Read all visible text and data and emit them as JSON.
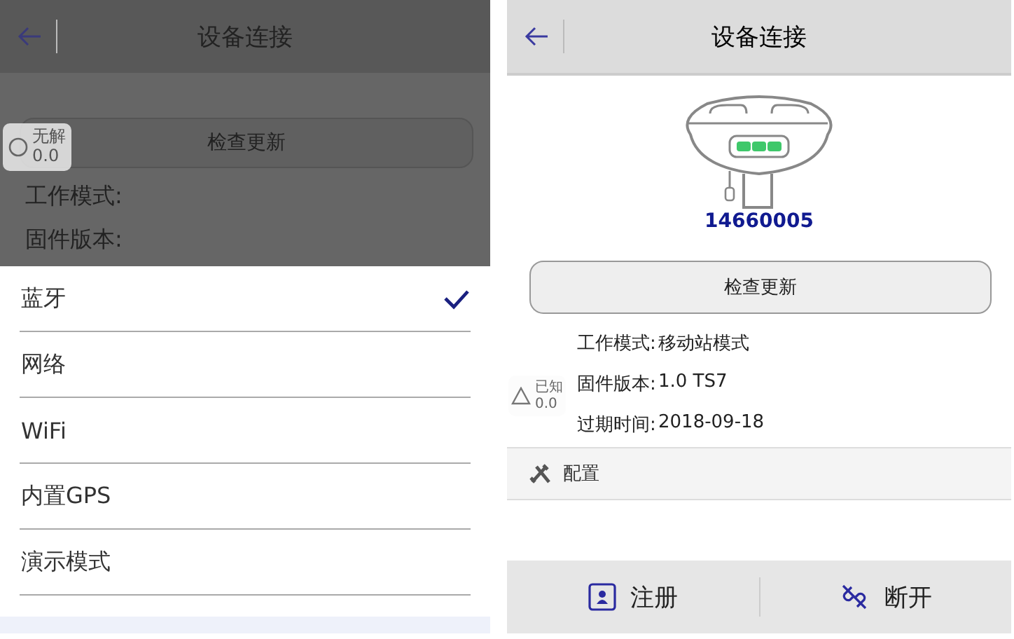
{
  "left": {
    "title": "设备连接",
    "update_button": "检查更新",
    "fields": [
      {
        "label": "工作模式:"
      },
      {
        "label": "固件版本:"
      }
    ],
    "badge": {
      "kind": "circle",
      "label": "无解",
      "value": "0.0"
    },
    "options": [
      {
        "label": "蓝牙",
        "selected": true
      },
      {
        "label": "网络",
        "selected": false
      },
      {
        "label": "WiFi",
        "selected": false
      },
      {
        "label": "内置GPS",
        "selected": false
      },
      {
        "label": "演示模式",
        "selected": false
      }
    ]
  },
  "right": {
    "title": "设备连接",
    "serial": "14660005",
    "update_button": "检查更新",
    "fields": [
      {
        "label": "工作模式:",
        "value": "移动站模式"
      },
      {
        "label": "固件版本:",
        "value": "1.0  TS7"
      },
      {
        "label": "过期时间:",
        "value": "2018-09-18"
      }
    ],
    "badge": {
      "kind": "triangle",
      "label": "已知",
      "value": "0.0"
    },
    "section": "配置",
    "actions": [
      {
        "kind": "register",
        "label": "注册"
      },
      {
        "kind": "disconnect",
        "label": "断开"
      }
    ]
  }
}
